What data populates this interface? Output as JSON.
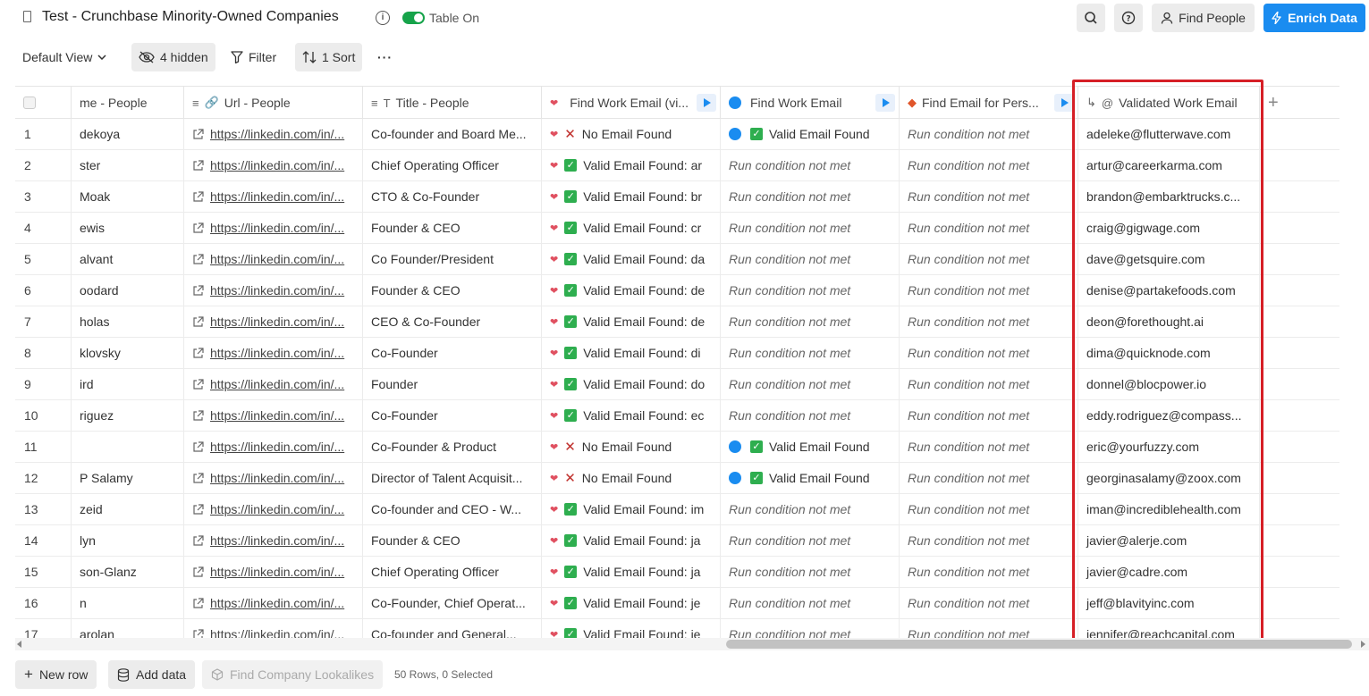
{
  "header": {
    "title": "Test - Crunchbase Minority-Owned Companies",
    "toggle_label": "Table On",
    "find_people": "Find People",
    "enrich_data": "Enrich Data",
    "accent": "#1a8cf0"
  },
  "toolbar": {
    "view": "Default View",
    "hidden": "4 hidden",
    "filter": "Filter",
    "sort": "1 Sort",
    "more": "···"
  },
  "columns": [
    {
      "label": "me - People"
    },
    {
      "label": "Url - People"
    },
    {
      "label": "Title - People"
    },
    {
      "label": "Find Work Email (vi..."
    },
    {
      "label": "Find Work Email"
    },
    {
      "label": "Find Email for Pers..."
    },
    {
      "label": "Validated Work Email"
    }
  ],
  "rows": [
    {
      "n": "1",
      "name": "dekoya",
      "url": "https://linkedin.com/in/...",
      "title": "Co-founder and Board Me...",
      "fwe1": "No Email Found",
      "fwe1_ok": false,
      "fwe2": "Valid Email Found",
      "fwe2_mode": "valid",
      "fep": "Run condition not met",
      "email": "adeleke@flutterwave.com"
    },
    {
      "n": "2",
      "name": "ster",
      "url": "https://linkedin.com/in/...",
      "title": "Chief Operating Officer",
      "fwe1": "Valid Email Found: ar",
      "fwe1_ok": true,
      "fwe2": "Run condition not met",
      "fwe2_mode": "none",
      "fep": "Run condition not met",
      "email": "artur@careerkarma.com"
    },
    {
      "n": "3",
      "name": "Moak",
      "url": "https://linkedin.com/in/...",
      "title": "CTO & Co-Founder",
      "fwe1": "Valid Email Found: br",
      "fwe1_ok": true,
      "fwe2": "Run condition not met",
      "fwe2_mode": "none",
      "fep": "Run condition not met",
      "email": "brandon@embarktrucks.c..."
    },
    {
      "n": "4",
      "name": "ewis",
      "url": "https://linkedin.com/in/...",
      "title": "Founder & CEO",
      "fwe1": "Valid Email Found: cr",
      "fwe1_ok": true,
      "fwe2": "Run condition not met",
      "fwe2_mode": "none",
      "fep": "Run condition not met",
      "email": "craig@gigwage.com"
    },
    {
      "n": "5",
      "name": "alvant",
      "url": "https://linkedin.com/in/...",
      "title": "Co Founder/President",
      "fwe1": "Valid Email Found: da",
      "fwe1_ok": true,
      "fwe2": "Run condition not met",
      "fwe2_mode": "none",
      "fep": "Run condition not met",
      "email": "dave@getsquire.com"
    },
    {
      "n": "6",
      "name": "oodard",
      "url": "https://linkedin.com/in/...",
      "title": "Founder & CEO",
      "fwe1": "Valid Email Found: de",
      "fwe1_ok": true,
      "fwe2": "Run condition not met",
      "fwe2_mode": "none",
      "fep": "Run condition not met",
      "email": "denise@partakefoods.com"
    },
    {
      "n": "7",
      "name": "holas",
      "url": "https://linkedin.com/in/...",
      "title": "CEO & Co-Founder",
      "fwe1": "Valid Email Found: de",
      "fwe1_ok": true,
      "fwe2": "Run condition not met",
      "fwe2_mode": "none",
      "fep": "Run condition not met",
      "email": "deon@forethought.ai"
    },
    {
      "n": "8",
      "name": "klovsky",
      "url": "https://linkedin.com/in/...",
      "title": "Co-Founder",
      "fwe1": "Valid Email Found: di",
      "fwe1_ok": true,
      "fwe2": "Run condition not met",
      "fwe2_mode": "none",
      "fep": "Run condition not met",
      "email": "dima@quicknode.com"
    },
    {
      "n": "9",
      "name": "ird",
      "url": "https://linkedin.com/in/...",
      "title": "Founder",
      "fwe1": "Valid Email Found: do",
      "fwe1_ok": true,
      "fwe2": "Run condition not met",
      "fwe2_mode": "none",
      "fep": "Run condition not met",
      "email": "donnel@blocpower.io"
    },
    {
      "n": "10",
      "name": "riguez",
      "url": "https://linkedin.com/in/...",
      "title": "Co-Founder",
      "fwe1": "Valid Email Found: ec",
      "fwe1_ok": true,
      "fwe2": "Run condition not met",
      "fwe2_mode": "none",
      "fep": "Run condition not met",
      "email": "eddy.rodriguez@compass..."
    },
    {
      "n": "11",
      "name": "",
      "url": "https://linkedin.com/in/...",
      "title": "Co-Founder & Product",
      "fwe1": "No Email Found",
      "fwe1_ok": false,
      "fwe2": "Valid Email Found",
      "fwe2_mode": "valid",
      "fep": "Run condition not met",
      "email": "eric@yourfuzzy.com"
    },
    {
      "n": "12",
      "name": "P Salamy",
      "url": "https://linkedin.com/in/...",
      "title": "Director of Talent Acquisit...",
      "fwe1": "No Email Found",
      "fwe1_ok": false,
      "fwe2": "Valid Email Found",
      "fwe2_mode": "valid",
      "fep": "Run condition not met",
      "email": "georginasalamy@zoox.com"
    },
    {
      "n": "13",
      "name": "zeid",
      "url": "https://linkedin.com/in/...",
      "title": "Co-founder and CEO - W...",
      "fwe1": "Valid Email Found: im",
      "fwe1_ok": true,
      "fwe2": "Run condition not met",
      "fwe2_mode": "none",
      "fep": "Run condition not met",
      "email": "iman@incrediblehealth.com"
    },
    {
      "n": "14",
      "name": "lyn",
      "url": "https://linkedin.com/in/...",
      "title": "Founder & CEO",
      "fwe1": "Valid Email Found: ja",
      "fwe1_ok": true,
      "fwe2": "Run condition not met",
      "fwe2_mode": "none",
      "fep": "Run condition not met",
      "email": "javier@alerje.com"
    },
    {
      "n": "15",
      "name": "son-Glanz",
      "url": "https://linkedin.com/in/...",
      "title": "Chief Operating Officer",
      "fwe1": "Valid Email Found: ja",
      "fwe1_ok": true,
      "fwe2": "Run condition not met",
      "fwe2_mode": "none",
      "fep": "Run condition not met",
      "email": "javier@cadre.com"
    },
    {
      "n": "16",
      "name": "n",
      "url": "https://linkedin.com/in/...",
      "title": "Co-Founder, Chief Operat...",
      "fwe1": "Valid Email Found: je",
      "fwe1_ok": true,
      "fwe2": "Run condition not met",
      "fwe2_mode": "none",
      "fep": "Run condition not met",
      "email": "jeff@blavityinc.com"
    },
    {
      "n": "17",
      "name": "arolan",
      "url": "https://linkedin.com/in/...",
      "title": "Co-founder and General...",
      "fwe1": "Valid Email Found: je",
      "fwe1_ok": true,
      "fwe2": "Run condition not met",
      "fwe2_mode": "none",
      "fep": "Run condition not met",
      "email": "jennifer@reachcapital.com"
    }
  ],
  "footer": {
    "new_row": "New row",
    "add_data": "Add data",
    "lookalikes": "Find Company Lookalikes",
    "status": "50 Rows, 0 Selected"
  }
}
